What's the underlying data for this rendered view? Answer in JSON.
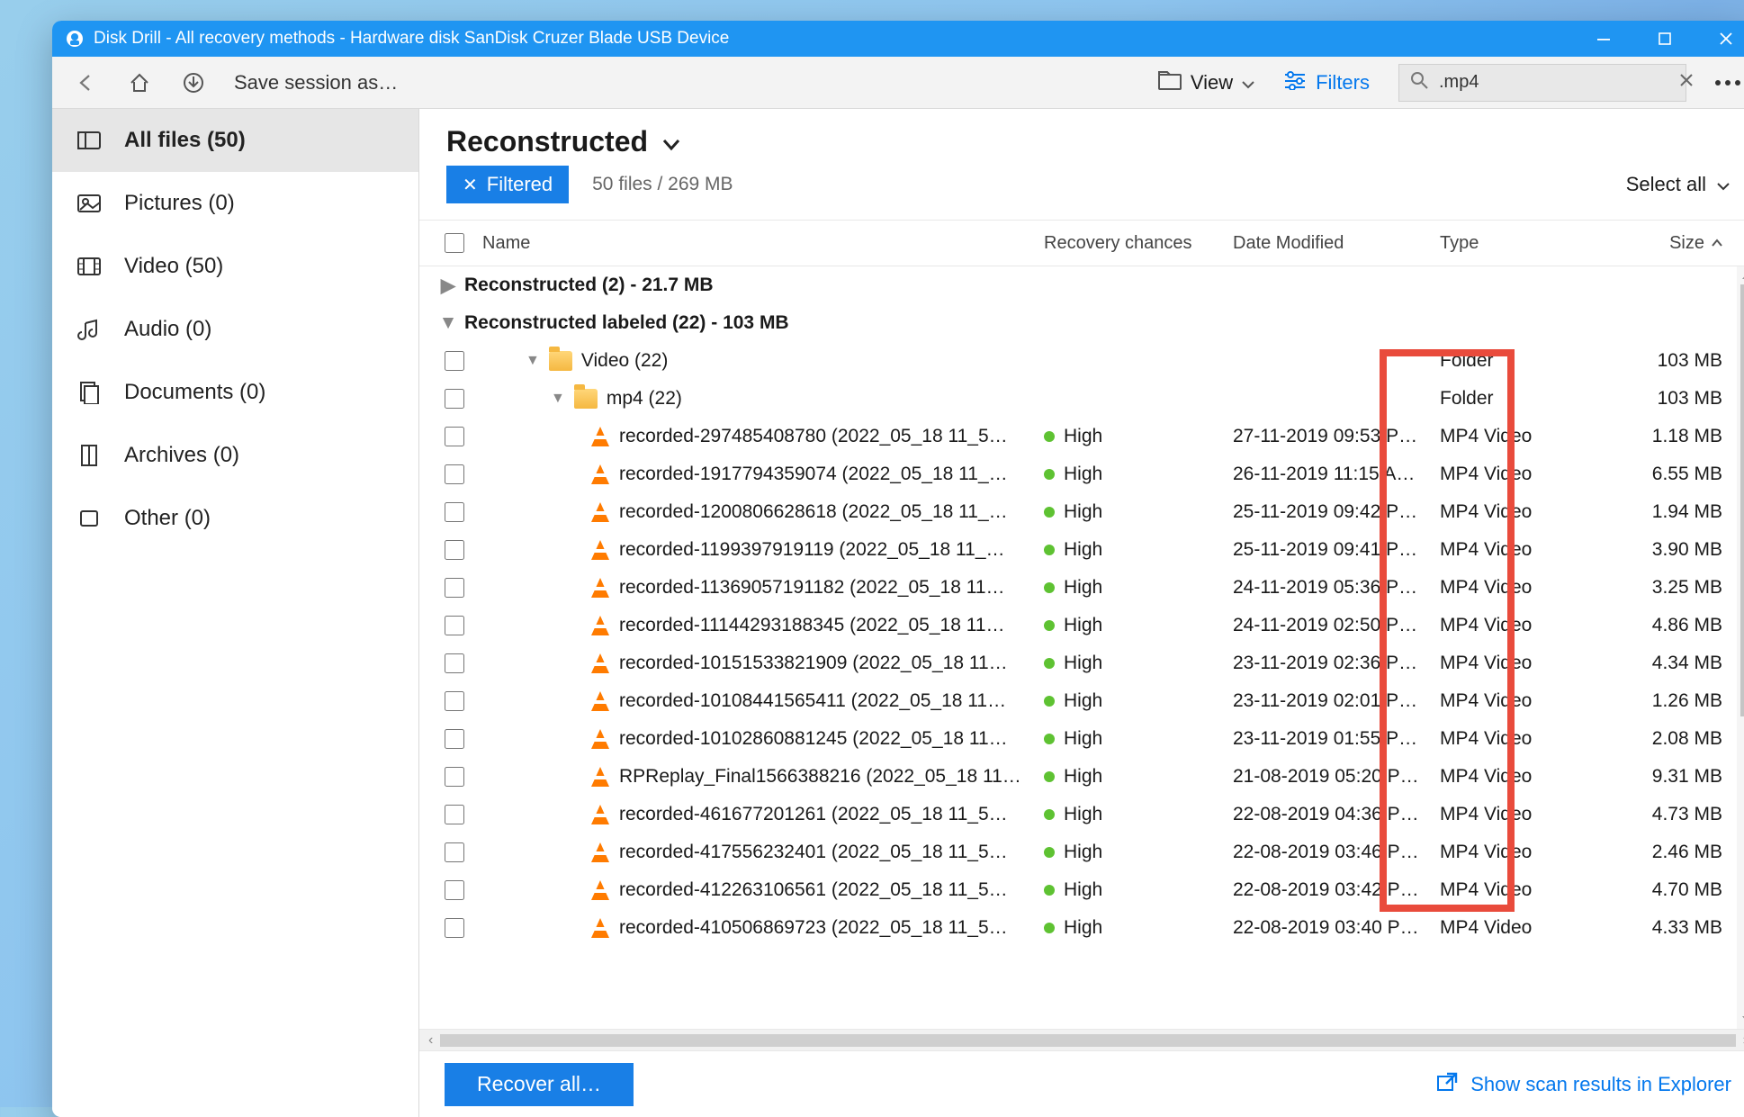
{
  "window": {
    "title": "Disk Drill - All recovery methods - Hardware disk SanDisk Cruzer Blade USB Device"
  },
  "toolbar": {
    "save_label": "Save session as…",
    "view_label": "View",
    "filters_label": "Filters",
    "search_value": ".mp4"
  },
  "sidebar": {
    "items": [
      {
        "icon": "files-icon",
        "label": "All files (50)",
        "selected": true
      },
      {
        "icon": "pictures-icon",
        "label": "Pictures (0)",
        "selected": false
      },
      {
        "icon": "video-icon",
        "label": "Video (50)",
        "selected": false
      },
      {
        "icon": "audio-icon",
        "label": "Audio (0)",
        "selected": false
      },
      {
        "icon": "documents-icon",
        "label": "Documents (0)",
        "selected": false
      },
      {
        "icon": "archives-icon",
        "label": "Archives (0)",
        "selected": false
      },
      {
        "icon": "other-icon",
        "label": "Other (0)",
        "selected": false
      }
    ]
  },
  "header": {
    "title": "Reconstructed",
    "chip_label": "Filtered",
    "summary": "50 files / 269 MB",
    "select_all": "Select all"
  },
  "columns": {
    "name": "Name",
    "recovery": "Recovery chances",
    "date": "Date Modified",
    "type": "Type",
    "size": "Size"
  },
  "groups": [
    {
      "label": "Reconstructed (2) - 21.7 MB",
      "expanded": false
    },
    {
      "label": "Reconstructed labeled (22) - 103 MB",
      "expanded": true
    }
  ],
  "folders": [
    {
      "indent": 1,
      "label": "Video (22)",
      "type": "Folder",
      "size": "103 MB"
    },
    {
      "indent": 2,
      "label": "mp4 (22)",
      "type": "Folder",
      "size": "103 MB"
    }
  ],
  "files": [
    {
      "name": "recorded-297485408780 (2022_05_18 11_5…",
      "rec": "High",
      "date": "27-11-2019 09:53 P…",
      "type": "MP4 Video",
      "size": "1.18 MB"
    },
    {
      "name": "recorded-1917794359074 (2022_05_18 11_…",
      "rec": "High",
      "date": "26-11-2019 11:15 A…",
      "type": "MP4 Video",
      "size": "6.55 MB"
    },
    {
      "name": "recorded-1200806628618 (2022_05_18 11_…",
      "rec": "High",
      "date": "25-11-2019 09:42 P…",
      "type": "MP4 Video",
      "size": "1.94 MB"
    },
    {
      "name": "recorded-1199397919119 (2022_05_18 11_…",
      "rec": "High",
      "date": "25-11-2019 09:41 P…",
      "type": "MP4 Video",
      "size": "3.90 MB"
    },
    {
      "name": "recorded-11369057191182 (2022_05_18 11…",
      "rec": "High",
      "date": "24-11-2019 05:36 P…",
      "type": "MP4 Video",
      "size": "3.25 MB"
    },
    {
      "name": "recorded-11144293188345 (2022_05_18 11…",
      "rec": "High",
      "date": "24-11-2019 02:50 P…",
      "type": "MP4 Video",
      "size": "4.86 MB"
    },
    {
      "name": "recorded-10151533821909 (2022_05_18 11…",
      "rec": "High",
      "date": "23-11-2019 02:36 P…",
      "type": "MP4 Video",
      "size": "4.34 MB"
    },
    {
      "name": "recorded-10108441565411 (2022_05_18 11…",
      "rec": "High",
      "date": "23-11-2019 02:01 P…",
      "type": "MP4 Video",
      "size": "1.26 MB"
    },
    {
      "name": "recorded-10102860881245 (2022_05_18 11…",
      "rec": "High",
      "date": "23-11-2019 01:55 P…",
      "type": "MP4 Video",
      "size": "2.08 MB"
    },
    {
      "name": "RPReplay_Final1566388216 (2022_05_18 11…",
      "rec": "High",
      "date": "21-08-2019 05:20 P…",
      "type": "MP4 Video",
      "size": "9.31 MB"
    },
    {
      "name": "recorded-461677201261 (2022_05_18 11_5…",
      "rec": "High",
      "date": "22-08-2019 04:36 P…",
      "type": "MP4 Video",
      "size": "4.73 MB"
    },
    {
      "name": "recorded-417556232401 (2022_05_18 11_5…",
      "rec": "High",
      "date": "22-08-2019 03:46 P…",
      "type": "MP4 Video",
      "size": "2.46 MB"
    },
    {
      "name": "recorded-412263106561 (2022_05_18 11_5…",
      "rec": "High",
      "date": "22-08-2019 03:42 P…",
      "type": "MP4 Video",
      "size": "4.70 MB"
    },
    {
      "name": "recorded-410506869723 (2022_05_18 11_5…",
      "rec": "High",
      "date": "22-08-2019 03:40 P…",
      "type": "MP4 Video",
      "size": "4.33 MB"
    }
  ],
  "footer": {
    "recover_label": "Recover all…",
    "explorer_label": "Show scan results in Explorer"
  }
}
